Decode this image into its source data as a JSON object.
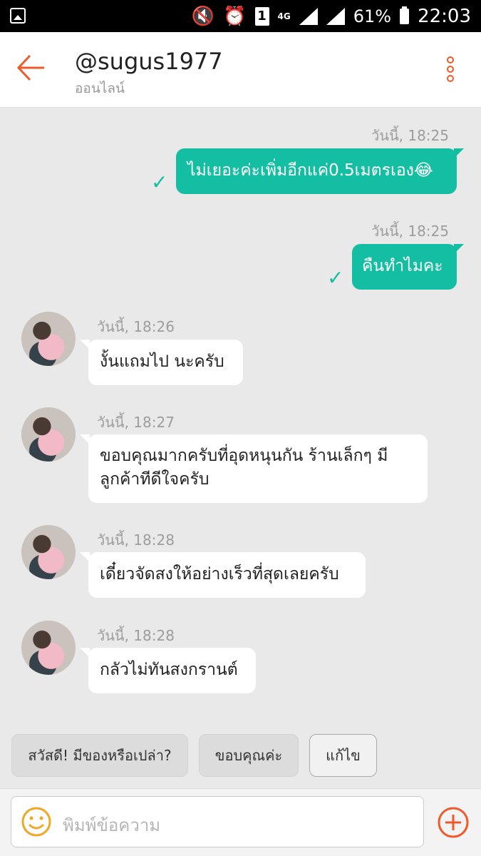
{
  "status_bar": {
    "network": "4G",
    "sim": "1",
    "battery_percent": "61%",
    "time": "22:03"
  },
  "header": {
    "title": "@sugus1977",
    "subtitle": "ออนไลน์",
    "accent_color": "#ee5a2b"
  },
  "messages": [
    {
      "direction": "out",
      "timestamp": "วันนี้, 18:25",
      "text": "ไม่เยอะค่ะเพิ่มอีกแค่0.5เมตรเอง😂"
    },
    {
      "direction": "out",
      "timestamp": "วันนี้, 18:25",
      "text": "คืนทำไมคะ"
    },
    {
      "direction": "in",
      "timestamp": "วันนี้, 18:26",
      "text": "งั้นแถมไป นะครับ"
    },
    {
      "direction": "in",
      "timestamp": "วันนี้, 18:27",
      "text_line1": "ขอบคุณมากครับที่อุดหนุนกัน  ร้านเล็กๆ มี",
      "text_line2": "ลูกค้าทีดีใจครับ"
    },
    {
      "direction": "in",
      "timestamp": "วันนี้, 18:28",
      "text": "เดี๋ยวจัดสงให้อย่างเร็วที่สุดเลยครับ"
    },
    {
      "direction": "in",
      "timestamp": "วันนี้, 18:28",
      "text": "กลัวไม่ทันสงกรานต์"
    }
  ],
  "quick_replies": [
    "สวัสดี! มีของหรือเปล่า?",
    "ขอบคุณค่ะ",
    "แก้ไข"
  ],
  "input": {
    "placeholder": "พิมพ์ข้อความ"
  },
  "colors": {
    "outgoing_bubble": "#14bea2",
    "incoming_bubble": "#ffffff",
    "chat_background": "#e9e9e9"
  }
}
